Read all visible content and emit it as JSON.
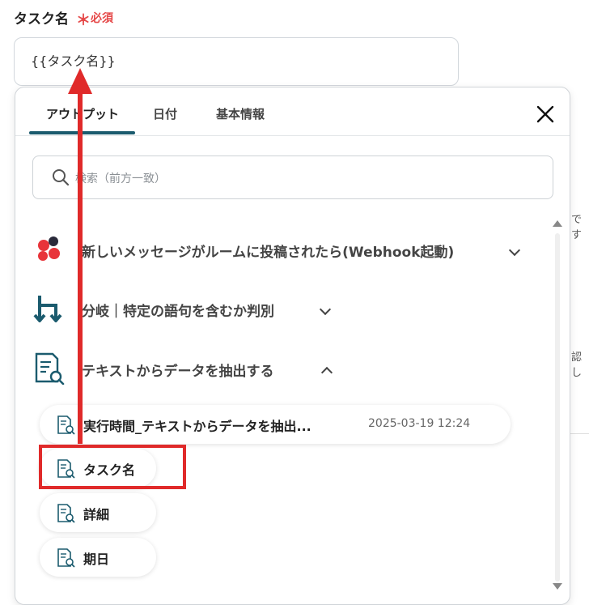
{
  "field": {
    "label": "タスク名",
    "required_mark": "＊",
    "required_text": "必須",
    "value": "{{タスク名}}"
  },
  "background": {
    "text_1": "です",
    "text_2": "認し"
  },
  "panel": {
    "tabs": [
      {
        "label": "アウトプット",
        "active": true
      },
      {
        "label": "日付",
        "active": false
      },
      {
        "label": "基本情報",
        "active": false
      }
    ],
    "search_placeholder": "検索（前方一致）",
    "sections": [
      {
        "label": "新しいメッセージがルームに投稿されたら(Webhook起動)",
        "icon": "chatwork-icon",
        "expanded": false
      },
      {
        "label": "分岐｜特定の語句を含むか判別",
        "icon": "branch-icon",
        "expanded": false
      },
      {
        "label": "テキストからデータを抽出する",
        "icon": "document-search-icon",
        "expanded": true
      }
    ],
    "items": [
      {
        "label": "実行時間_テキストからデータを抽出...",
        "timestamp": "2025-03-19 12:24"
      },
      {
        "label": "タスク名"
      },
      {
        "label": "詳細"
      },
      {
        "label": "期日"
      }
    ]
  },
  "colors": {
    "accent": "#1b5b6e",
    "annotation_red": "#e02a2a",
    "required_red": "#e54848"
  }
}
